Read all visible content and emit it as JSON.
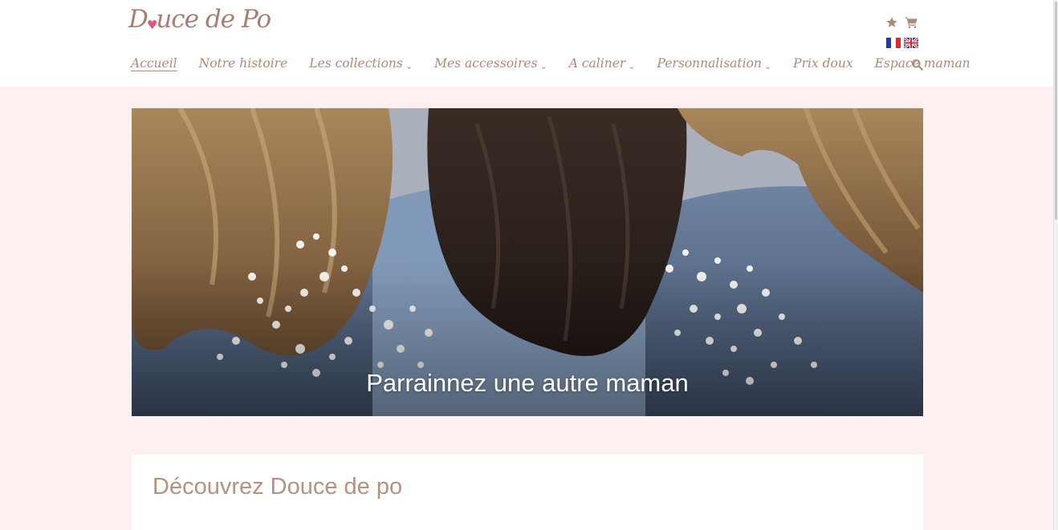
{
  "brand": {
    "logo_text_1": "D",
    "logo_text_2": "uce de Po"
  },
  "utility": {
    "icons": [
      "star-icon",
      "cart-icon"
    ],
    "languages": [
      "fr-flag",
      "uk-flag"
    ]
  },
  "nav": {
    "items": [
      {
        "label": "Accueil",
        "active": true,
        "dropdown": false
      },
      {
        "label": "Notre histoire",
        "dropdown": false
      },
      {
        "label": "Les collections",
        "dropdown": true
      },
      {
        "label": "Mes accessoires",
        "dropdown": true
      },
      {
        "label": "A caliner",
        "dropdown": true
      },
      {
        "label": "Personnalisation",
        "dropdown": true
      },
      {
        "label": "Prix doux",
        "dropdown": false
      },
      {
        "label": "Espace maman",
        "dropdown": false
      }
    ],
    "search_icon": "search-icon"
  },
  "hero": {
    "caption": "Parrainnez une autre maman"
  },
  "section": {
    "title": "Découvrez Douce de po"
  },
  "colors": {
    "accent": "#b08979",
    "background": "#fdf0ee",
    "heart": "#e0557a"
  }
}
